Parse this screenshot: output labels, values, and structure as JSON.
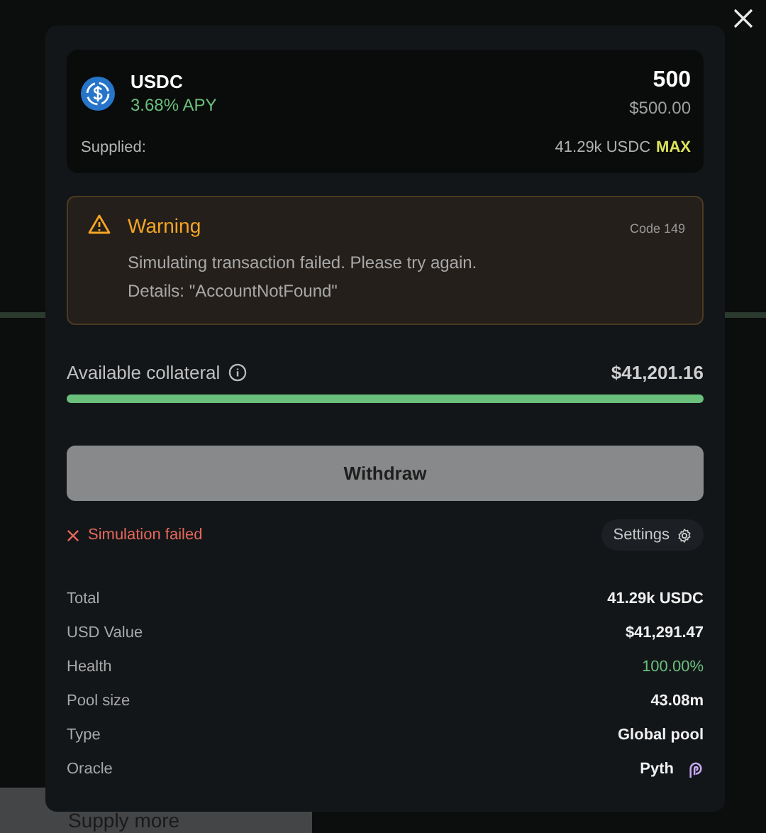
{
  "page": {
    "supply_button": "Supply more"
  },
  "modal": {
    "asset": {
      "symbol": "USDC",
      "apy": "3.68% APY",
      "amount": "500",
      "amount_usd": "$500.00",
      "supplied_label": "Supplied:",
      "supplied_value": "41.29k USDC",
      "max_label": "MAX"
    },
    "warning": {
      "title": "Warning",
      "code": "Code 149",
      "lines": [
        "Simulating transaction failed. Please try again.",
        "Details: \"AccountNotFound\""
      ]
    },
    "collateral": {
      "label": "Available collateral",
      "value": "$41,201.16",
      "level": 1.0
    },
    "action_button": {
      "label": "Withdraw",
      "disabled": true
    },
    "status": {
      "text": "Simulation failed",
      "kind": "error"
    },
    "settings_button": "Settings",
    "stats": [
      {
        "label": "Total",
        "value": "41.29k USDC",
        "kind": "plain"
      },
      {
        "label": "USD Value",
        "value": "$41,291.47",
        "kind": "plain"
      },
      {
        "label": "Health",
        "value": "100.00%",
        "kind": "good"
      },
      {
        "label": "Pool size",
        "value": "43.08m",
        "kind": "plain"
      },
      {
        "label": "Type",
        "value": "Global pool",
        "kind": "plain"
      },
      {
        "label": "Oracle",
        "value": "Pyth",
        "kind": "oracle"
      }
    ]
  }
}
